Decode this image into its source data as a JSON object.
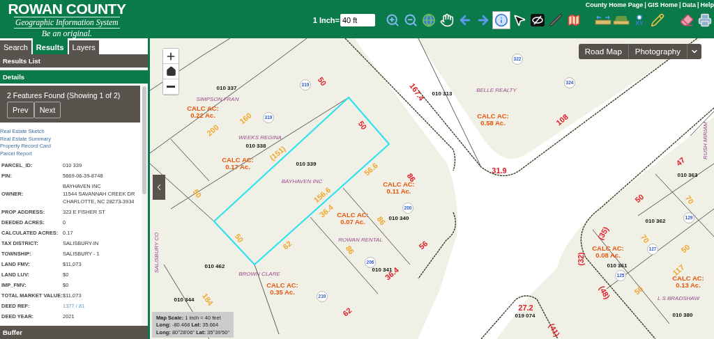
{
  "header": {
    "logo": {
      "title": "ROWAN COUNTY",
      "subtitle": "Geographic Information System",
      "tagline": "Be an original."
    },
    "links": [
      "County Home Page",
      "GIS Home",
      "Data",
      "Help"
    ],
    "link_separator": "|",
    "scale": {
      "label": "1 Inch=",
      "value": "40 ft"
    },
    "tools": [
      {
        "kind": "zoom-in",
        "selected": false
      },
      {
        "kind": "zoom-out",
        "selected": false
      },
      {
        "kind": "globe",
        "selected": false
      },
      {
        "kind": "hand",
        "selected": false
      },
      {
        "kind": "back",
        "selected": false
      },
      {
        "kind": "forward",
        "selected": false
      },
      {
        "kind": "info",
        "selected": true
      },
      {
        "kind": "pointer",
        "selected": false
      },
      {
        "kind": "clear-select",
        "selected": false
      },
      {
        "kind": "line",
        "selected": false
      },
      {
        "kind": "map",
        "selected": false
      },
      {
        "kind": "measure",
        "selected": false
      },
      {
        "kind": "area",
        "selected": false
      },
      {
        "kind": "xy",
        "label": "XY",
        "selected": false
      },
      {
        "kind": "pencil",
        "selected": false
      },
      {
        "kind": "eraser",
        "selected": false
      },
      {
        "kind": "print",
        "selected": false
      }
    ]
  },
  "sidebar": {
    "tabs": [
      {
        "label": "Search",
        "selected": false
      },
      {
        "label": "Results",
        "selected": true
      },
      {
        "label": "Layers",
        "selected": false
      }
    ],
    "sections": [
      "Results List",
      "Details"
    ],
    "summary": "2 Features Found (Showing 1 of 2)",
    "pager": [
      "Prev",
      "Next"
    ],
    "links": [
      "Real Estate Sketch",
      "Real Estate Summary",
      "Property Record Card",
      "Parcel Report"
    ],
    "attributes": [
      {
        "name": "PARCEL_ID:",
        "value": [
          "010 339"
        ]
      },
      {
        "name": "PIN:",
        "value": [
          "5669-06-39-8748"
        ]
      },
      {
        "name": "OWNER:",
        "value": [
          "BAYHAVEN INC",
          "11544 SAVANNAH CREEK DR",
          "CHARLOTTE, NC 28273-3934"
        ]
      },
      {
        "name": "PROP ADDRESS:",
        "value": [
          "323 E FISHER ST"
        ]
      },
      {
        "name": "DEEDED ACRES:",
        "value": [
          "0"
        ]
      },
      {
        "name": "CALCULATED ACRES:",
        "value": [
          "0.17"
        ]
      },
      {
        "name": "TAX DISTRICT:",
        "value": [
          "SALISBURY-IN"
        ]
      },
      {
        "name": "TOWNSHIP:",
        "value": [
          "SALISBURY - 1"
        ]
      },
      {
        "name": "LAND FMV:",
        "value": [
          "$11,073"
        ]
      },
      {
        "name": "LAND LUV:",
        "value": [
          "$0"
        ]
      },
      {
        "name": "IMP_FMV:",
        "value": [
          "$0"
        ]
      },
      {
        "name": "TOTAL MARKET VALUE:",
        "value": [
          "$11,073"
        ]
      },
      {
        "name": "DEED REF:",
        "value": [
          "1377 / 81"
        ],
        "link": true
      },
      {
        "name": "DEED YEAR:",
        "value": [
          "2021"
        ]
      }
    ],
    "footer_section": "Buffer"
  },
  "map": {
    "basemaps": [
      {
        "label": "Road Map"
      },
      {
        "label": "Photography"
      }
    ],
    "scale_box": [
      "**Map Scale:** 1 inch = 40 feet",
      "**Long:** -80.468 **Lat:** 35.664",
      "**Long:** 80°28'06\" **Lat:** 35°39'50\""
    ],
    "labels": [
      {
        "kind": "owner",
        "text": "SIMPSON FRAN"
      },
      {
        "kind": "acreage",
        "title": "CALC AC:",
        "text": "0.22 Ac."
      },
      {
        "kind": "parcel",
        "text": "010 337"
      },
      {
        "kind": "dimension",
        "text": "160"
      },
      {
        "kind": "dimension",
        "text": "200"
      },
      {
        "kind": "address",
        "text": "319"
      },
      {
        "kind": "address",
        "text": "319"
      },
      {
        "kind": "frontage",
        "text": "50"
      },
      {
        "kind": "frontage",
        "text": "167.4"
      },
      {
        "kind": "owner",
        "text": "WEEKS REGINA"
      },
      {
        "kind": "parcel",
        "text": "010 338"
      },
      {
        "kind": "dimension",
        "text": "(151)"
      },
      {
        "kind": "acreage",
        "title": "CALC AC:",
        "text": "0.17 Ac."
      },
      {
        "kind": "parcel",
        "text": "010 339"
      },
      {
        "kind": "frontage",
        "text": "50"
      },
      {
        "kind": "owner",
        "text": "BAYHAVEN INC"
      },
      {
        "kind": "dimension",
        "text": "56.6"
      },
      {
        "kind": "frontage",
        "text": "86"
      },
      {
        "kind": "acreage",
        "title": "CALC AC:",
        "text": "0.11 Ac."
      },
      {
        "kind": "dimension",
        "text": "50"
      },
      {
        "kind": "dimension",
        "text": "156.6"
      },
      {
        "kind": "dimension",
        "text": "36.4"
      },
      {
        "kind": "acreage",
        "title": "CALC AC:",
        "text": "0.07 Ac."
      },
      {
        "kind": "address",
        "text": "200"
      },
      {
        "kind": "parcel",
        "text": "010 340"
      },
      {
        "kind": "dimension",
        "text": "86"
      },
      {
        "kind": "dimension",
        "text": "50"
      },
      {
        "kind": "dimension",
        "text": "62"
      },
      {
        "kind": "owner",
        "text": "ROWAN RENTAL"
      },
      {
        "kind": "dimension",
        "text": "86"
      },
      {
        "kind": "frontage",
        "text": "56"
      },
      {
        "kind": "owner",
        "text": "SALISBURY CO"
      },
      {
        "kind": "address",
        "text": "206"
      },
      {
        "kind": "parcel",
        "text": "010 462"
      },
      {
        "kind": "parcel",
        "text": "010 341"
      },
      {
        "kind": "frontage",
        "text": "36.4"
      },
      {
        "kind": "owner",
        "text": "BROWN CLARE"
      },
      {
        "kind": "acreage",
        "title": "CALC AC:",
        "text": "0.35 Ac."
      },
      {
        "kind": "address",
        "text": "210"
      },
      {
        "kind": "parcel",
        "text": "010 344"
      },
      {
        "kind": "dimension",
        "text": "184"
      },
      {
        "kind": "frontage",
        "text": "62"
      },
      {
        "kind": "address",
        "text": "322"
      },
      {
        "kind": "address",
        "text": "324"
      },
      {
        "kind": "parcel",
        "text": "010 313"
      },
      {
        "kind": "owner",
        "text": "BELLE REALTY"
      },
      {
        "kind": "acreage",
        "title": "CALC AC:",
        "text": "0.58 Ac."
      },
      {
        "kind": "frontage",
        "text": "108"
      },
      {
        "kind": "frontage",
        "text": "31.9"
      },
      {
        "kind": "owner",
        "text": "RUSH MIRIAM"
      },
      {
        "kind": "frontage",
        "text": "47"
      },
      {
        "kind": "parcel",
        "text": "010 363"
      },
      {
        "kind": "frontage",
        "text": "50"
      },
      {
        "kind": "dimension",
        "text": "70"
      },
      {
        "kind": "parcel",
        "text": "010 362"
      },
      {
        "kind": "address",
        "text": "129"
      },
      {
        "kind": "frontage",
        "text": "(35)"
      },
      {
        "kind": "dimension",
        "text": "70"
      },
      {
        "kind": "address",
        "text": "127"
      },
      {
        "kind": "dimension",
        "text": "50"
      },
      {
        "kind": "acreage",
        "title": "CALC AC:",
        "text": "0.08 Ac."
      },
      {
        "kind": "frontage",
        "text": "(32)"
      },
      {
        "kind": "parcel",
        "text": "010 361"
      },
      {
        "kind": "address",
        "text": "125"
      },
      {
        "kind": "dimension",
        "text": "117"
      },
      {
        "kind": "acreage",
        "title": "CALC AC:",
        "text": "0.13 Ac."
      },
      {
        "kind": "frontage",
        "text": "(48)"
      },
      {
        "kind": "dimension",
        "text": "50"
      },
      {
        "kind": "owner",
        "text": "L S BRADSHAW"
      },
      {
        "kind": "parcel",
        "text": "010 380"
      },
      {
        "kind": "frontage",
        "text": "27.2"
      },
      {
        "kind": "parcel",
        "text": "019 074"
      },
      {
        "kind": "frontage",
        "text": "(41)"
      }
    ]
  }
}
